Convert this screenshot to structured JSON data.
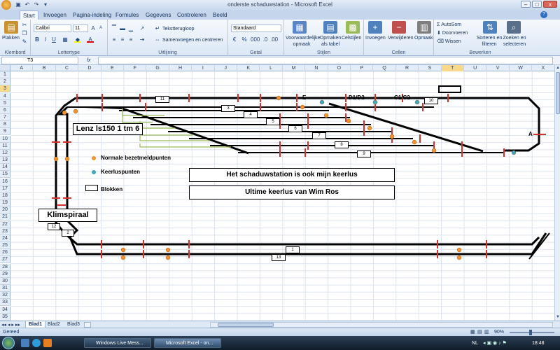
{
  "window": {
    "title": "onderste schaduwstation - Microsoft Excel"
  },
  "tabs": [
    "Start",
    "Invoegen",
    "Pagina-indeling",
    "Formules",
    "Gegevens",
    "Controleren",
    "Beeld"
  ],
  "ribbon": {
    "clipboard": {
      "paste": "Plakken",
      "label": "Klembord"
    },
    "font": {
      "name": "Calibri",
      "size": "11",
      "bold": "B",
      "italic": "I",
      "underline": "U",
      "label": "Lettertype"
    },
    "alignment": {
      "wrap": "Tekstterugloop",
      "merge": "Samenvoegen en centreren",
      "label": "Uitlijning"
    },
    "number": {
      "format": "Standaard",
      "label": "Getal"
    },
    "styles": {
      "conditional": "Voorwaardelijke opmaak",
      "table": "Opmaken als tabel",
      "cellstyles": "Celstijlen",
      "label": "Stijlen"
    },
    "cells": {
      "insert": "Invoegen",
      "delete": "Verwijderen",
      "format": "Opmaak",
      "label": "Cellen"
    },
    "editing": {
      "autosum": "AutoSom",
      "fill": "Doorvoeren",
      "clear": "Wissen",
      "sort": "Sorteren en filteren",
      "find": "Zoeken en selecteren",
      "label": "Bewerken"
    }
  },
  "formula_bar": {
    "name_box": "T3",
    "fx": "fx",
    "value": ""
  },
  "columns": [
    "A",
    "B",
    "C",
    "D",
    "E",
    "F",
    "G",
    "H",
    "I",
    "J",
    "K",
    "L",
    "M",
    "N",
    "O",
    "P",
    "Q",
    "R",
    "S",
    "T",
    "U",
    "V",
    "W",
    "X"
  ],
  "selected_column": "T",
  "selected_row": 3,
  "rows": [
    1,
    2,
    3,
    4,
    5,
    6,
    7,
    8,
    9,
    10,
    11,
    12,
    13,
    14,
    15,
    16,
    17,
    18,
    19,
    20,
    21,
    22,
    23,
    24,
    25,
    26,
    27,
    28,
    29,
    30,
    31,
    32,
    33,
    34,
    35
  ],
  "drawing": {
    "blocks": {
      "b1": "1",
      "b2": "2",
      "b3": "3",
      "b4": "4",
      "b5": "5",
      "b6": "6",
      "b7": "7",
      "b8": "8",
      "b9": "9",
      "b10": "10",
      "b11": "11",
      "b12": "12",
      "b13": "13"
    },
    "labels": {
      "e": "E",
      "d1d2": "D1/D2",
      "c1c2": "C1/C2",
      "a": "A"
    },
    "lenz": "Lenz ls150 1 tm 6",
    "klimspiraal": "Klimspiraal",
    "legend": {
      "detection": "Normale bezetmeldpunten",
      "turnaround": "Keerluspunten",
      "blocks": "Blokken"
    },
    "caption1": "Het schaduwstation is ook mijn keerlus",
    "caption2": "Ultime keerlus van Wim Ros",
    "colors": {
      "track": "#000000",
      "separator": "#d2322d",
      "detection": "#f0922e",
      "turnaround": "#3fa9b8",
      "lenz_arrow": "#9bbb59"
    }
  },
  "sheets": [
    "Blad1",
    "Blad2",
    "Blad3"
  ],
  "active_sheet": "Blad1",
  "status": {
    "text": "Gereed",
    "zoom": "90%"
  },
  "taskbar": {
    "apps": [
      "Windows Live Mess...",
      "Microsoft Excel - on..."
    ],
    "lang": "NL",
    "clock": "18:48"
  }
}
